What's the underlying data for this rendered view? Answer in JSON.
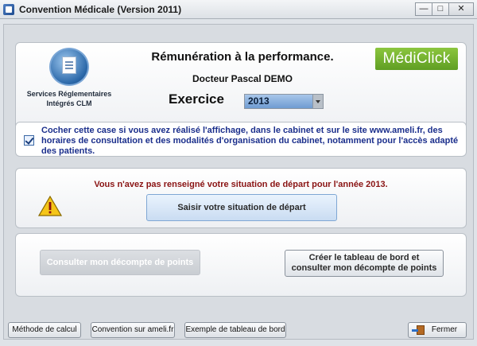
{
  "window": {
    "title": "Convention Médicale (Version 2011)",
    "controls": {
      "minimize": "—",
      "maximize": "□",
      "close": "✕"
    }
  },
  "header": {
    "logo_icon": "services-reglementaires-logo",
    "logo_caption": "Services Réglementaires Intégrés CLM",
    "title": "Rémunération à la performance.",
    "doctor": "Docteur Pascal DEMO",
    "exercice_label": "Exercice",
    "exercice_value": "2013",
    "brand": "MédiClick",
    "brand_color": "#76b52f"
  },
  "checkbox": {
    "checked": true,
    "text": "Cocher cette case si vous avez réalisé l'affichage, dans le cabinet et sur le site www.ameli.fr, des horaires de consultation et des modalités d'organisation du cabinet, notamment pour l'accès adapté des patients."
  },
  "warning": {
    "icon": "warning-icon",
    "message": "Vous n'avez pas renseigné votre situation de départ pour l'année 2013.",
    "button": "Saisir votre situation de départ"
  },
  "actions": {
    "consulter": "Consulter mon décompte de points",
    "creer_line1": "Créer le tableau de bord et",
    "creer_line2": "consulter mon décompte de points"
  },
  "footer": {
    "methode": "Méthode de calcul",
    "convention": "Convention sur ameli.fr",
    "exemple": "Exemple de tableau de bord",
    "fermer": "Fermer"
  }
}
